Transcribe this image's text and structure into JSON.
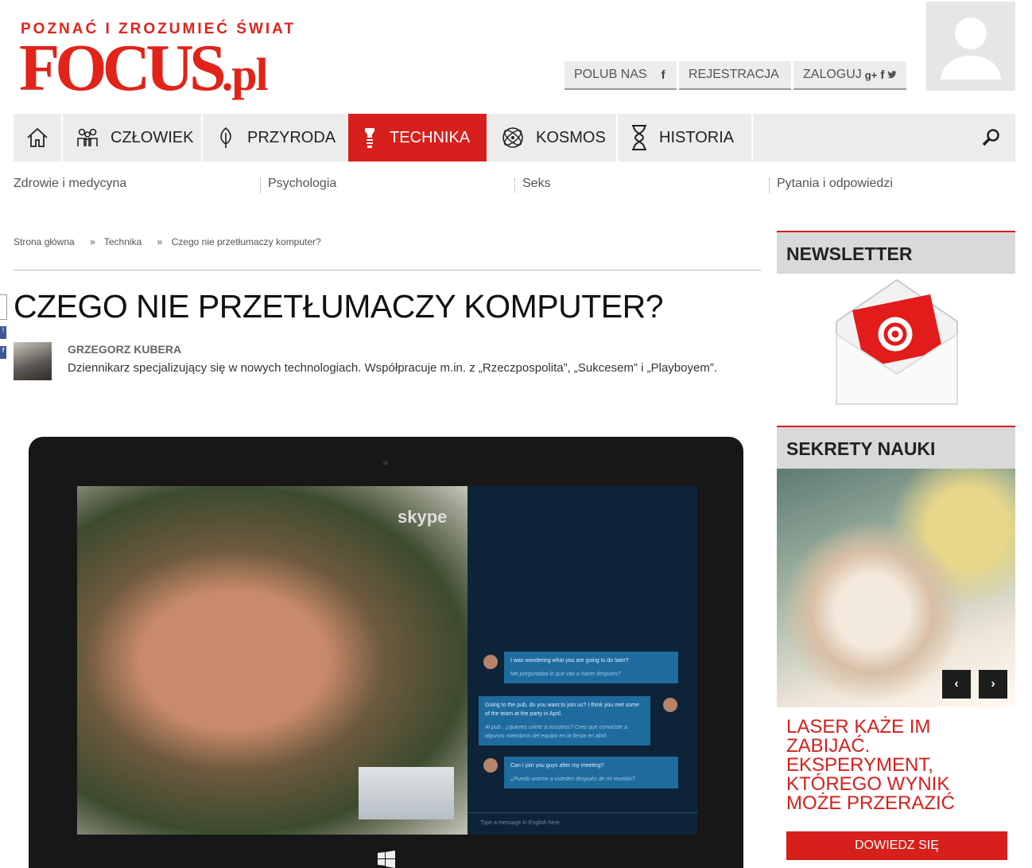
{
  "header": {
    "tagline": "POZNAĆ I ZROZUMIEĆ ŚWIAT",
    "logo_main": "FOCUS",
    "logo_suffix": ".pl",
    "like_label": "POLUB NAS",
    "register_label": "REJESTRACJA",
    "login_label": "ZALOGUJ"
  },
  "nav": {
    "items": [
      {
        "label": "CZŁOWIEK",
        "icon": "people-icon"
      },
      {
        "label": "PRZYRODA",
        "icon": "leaf-icon"
      },
      {
        "label": "TECHNIKA",
        "icon": "bulb-icon"
      },
      {
        "label": "KOSMOS",
        "icon": "atom-icon"
      },
      {
        "label": "HISTORIA",
        "icon": "hourglass-icon"
      }
    ],
    "active": "TECHNIKA",
    "sub": [
      "Zdrowie i medycyna",
      "Psychologia",
      "Seks",
      "Pytania i odpowiedzi"
    ]
  },
  "breadcrumb": [
    "Strona główna",
    "»",
    "Technika",
    "»",
    "Czego nie przetłumaczy komputer?"
  ],
  "article": {
    "title": "CZEGO NIE PRZETŁUMACZY KOMPUTER?",
    "author_name": "GRZEGORZ KUBERA",
    "author_bio": "Dziennikarz specjalizujący się w nowych technologiach. Współpracuje m.in. z „Rzeczpospolita”, „Sukcesem” i „Playboyem”."
  },
  "image": {
    "skype": "skype",
    "chat": [
      {
        "text": "I was wondering what you are going to do later?",
        "translation": "Me preguntaba lo que vas a hacer después?"
      },
      {
        "text": "Going to the pub, do you want to join us? I think you met some of the team at the party in April.",
        "translation": "Al pub , ¿quieres unirte a nosotros? Creo que conociste a algunos miembros del equipo en la fiesta en abril ."
      },
      {
        "text": "Can I join you guys after my meeting?",
        "translation": "¿Puedo unirme a ustedes después de mi reunión?"
      }
    ],
    "input_placeholder": "Type a message in English here"
  },
  "sidebar": {
    "newsletter_title": "NEWSLETTER",
    "section_title": "SEKRETY NAUKI",
    "promo_title": "LASER KAŻE IM ZABIJAĆ. EKSPERYMENT, KTÓREGO WYNIK MOŻE PRZERAZIĆ",
    "promo_button": "DOWIEDZ SIĘ"
  },
  "colors": {
    "accent": "#d71f1b",
    "nav_bg": "#ececec"
  }
}
